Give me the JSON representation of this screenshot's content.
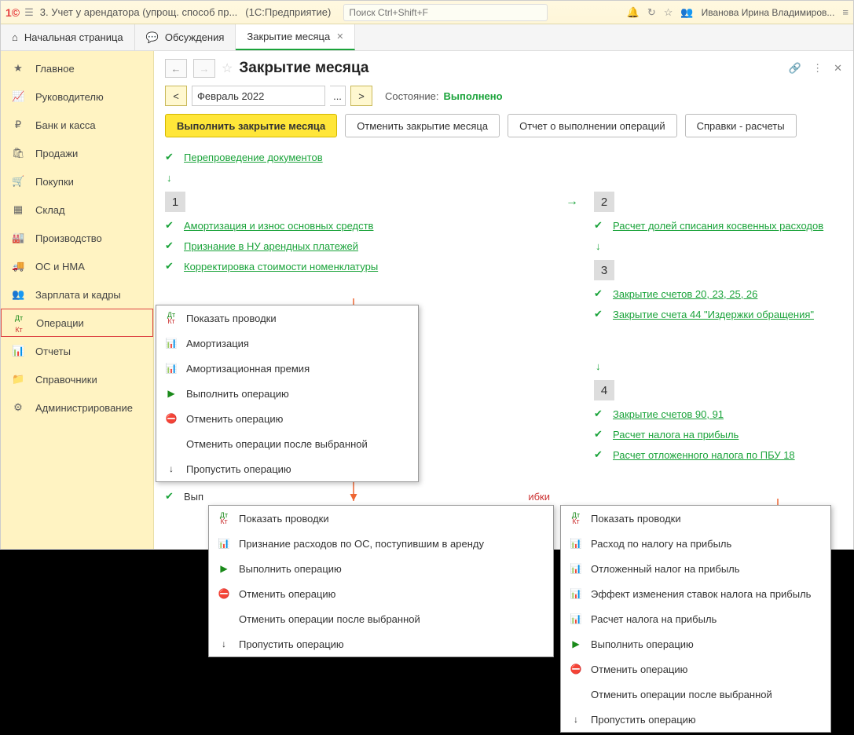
{
  "titlebar": {
    "appTitle": "3. Учет у арендатора (упрощ. способ пр...",
    "platform": "(1С:Предприятие)",
    "searchPlaceholder": "Поиск Ctrl+Shift+F",
    "userName": "Иванова Ирина Владимиров..."
  },
  "tabs": {
    "home": "Начальная страница",
    "discussions": "Обсуждения",
    "closing": "Закрытие месяца"
  },
  "sidebar": {
    "main": "Главное",
    "manager": "Руководителю",
    "bank": "Банк и касса",
    "sales": "Продажи",
    "purchases": "Покупки",
    "warehouse": "Склад",
    "production": "Производство",
    "assets": "ОС и НМА",
    "payroll": "Зарплата и кадры",
    "operations": "Операции",
    "reports": "Отчеты",
    "catalogs": "Справочники",
    "admin": "Администрирование"
  },
  "page": {
    "title": "Закрытие месяца",
    "period": "Февраль 2022",
    "prevBtn": "<",
    "nextBtn": ">",
    "dots": "...",
    "statusLabel": "Состояние:",
    "statusValue": "Выполнено"
  },
  "actions": {
    "execute": "Выполнить закрытие месяца",
    "cancel": "Отменить закрытие месяца",
    "report": "Отчет о выполнении операций",
    "refs": "Справки - расчеты"
  },
  "ops": {
    "repost": "Перепроведение документов",
    "s1": "1",
    "amort": "Амортизация и износ основных средств",
    "lease": "Признание в НУ арендных платежей",
    "cost": "Корректировка стоимости номенклатуры",
    "vyp": "Вып",
    "ibki": "ибки",
    "s2": "2",
    "indirect": "Расчет долей списания косвенных расходов",
    "s3": "3",
    "close20": "Закрытие счетов 20, 23, 25, 26",
    "close44": "Закрытие счета 44 \"Издержки обращения\"",
    "s4": "4",
    "close90": "Закрытие счетов 90, 91",
    "profitTax": "Расчет налога на прибыль",
    "deferred": "Расчет отложенного налога по ПБУ 18"
  },
  "menu1": {
    "show": "Показать проводки",
    "amort": "Амортизация",
    "prem": "Амортизационная премия",
    "exec": "Выполнить операцию",
    "cancel": "Отменить операцию",
    "cancelAfter": "Отменить операции после выбранной",
    "skip": "Пропустить операцию"
  },
  "menu2": {
    "show": "Показать проводки",
    "lease": "Признание расходов по ОС, поступившим в аренду",
    "exec": "Выполнить операцию",
    "cancel": "Отменить операцию",
    "cancelAfter": "Отменить операции после выбранной",
    "skip": "Пропустить операцию"
  },
  "menu3": {
    "show": "Показать проводки",
    "taxExpense": "Расход по налогу на прибыль",
    "deferredTax": "Отложенный налог на прибыль",
    "rateEffect": "Эффект изменения ставок налога на прибыль",
    "calcTax": "Расчет налога на прибыль",
    "exec": "Выполнить операцию",
    "cancel": "Отменить операцию",
    "cancelAfter": "Отменить операции после выбранной",
    "skip": "Пропустить операцию"
  }
}
